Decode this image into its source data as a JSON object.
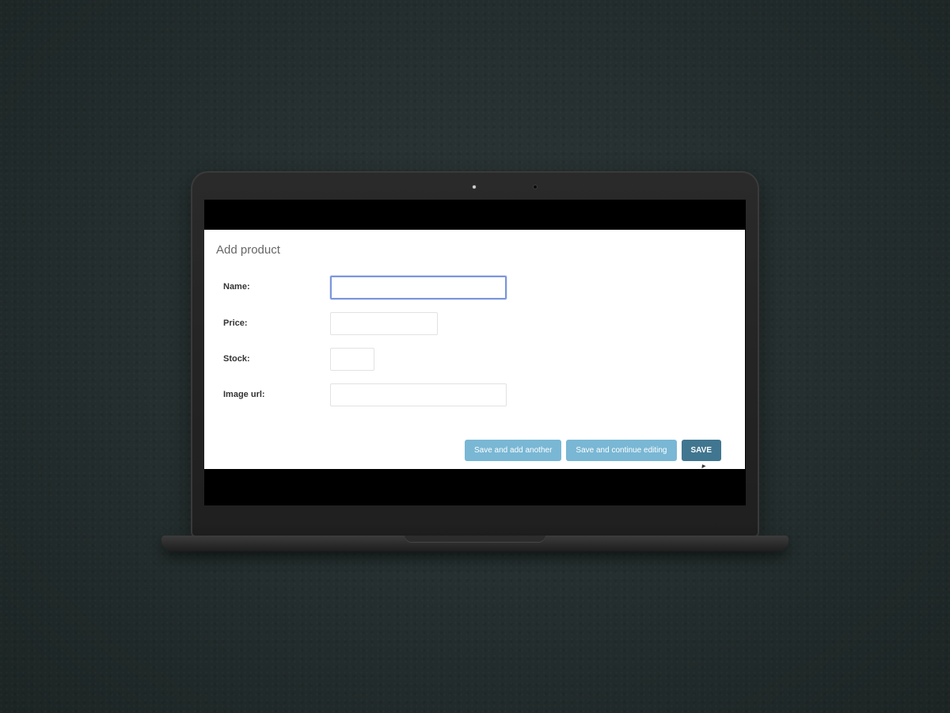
{
  "page": {
    "title": "Add product"
  },
  "form": {
    "fields": [
      {
        "label": "Name:",
        "value": "",
        "focused": true
      },
      {
        "label": "Price:",
        "value": ""
      },
      {
        "label": "Stock:",
        "value": ""
      },
      {
        "label": "Image url:",
        "value": ""
      }
    ]
  },
  "actions": {
    "save_add_another": "Save and add another",
    "save_continue": "Save and continue editing",
    "save": "SAVE"
  },
  "colors": {
    "primary_button": "#417690",
    "secondary_button": "#79b7d4",
    "focus_border": "#7b96dd"
  }
}
